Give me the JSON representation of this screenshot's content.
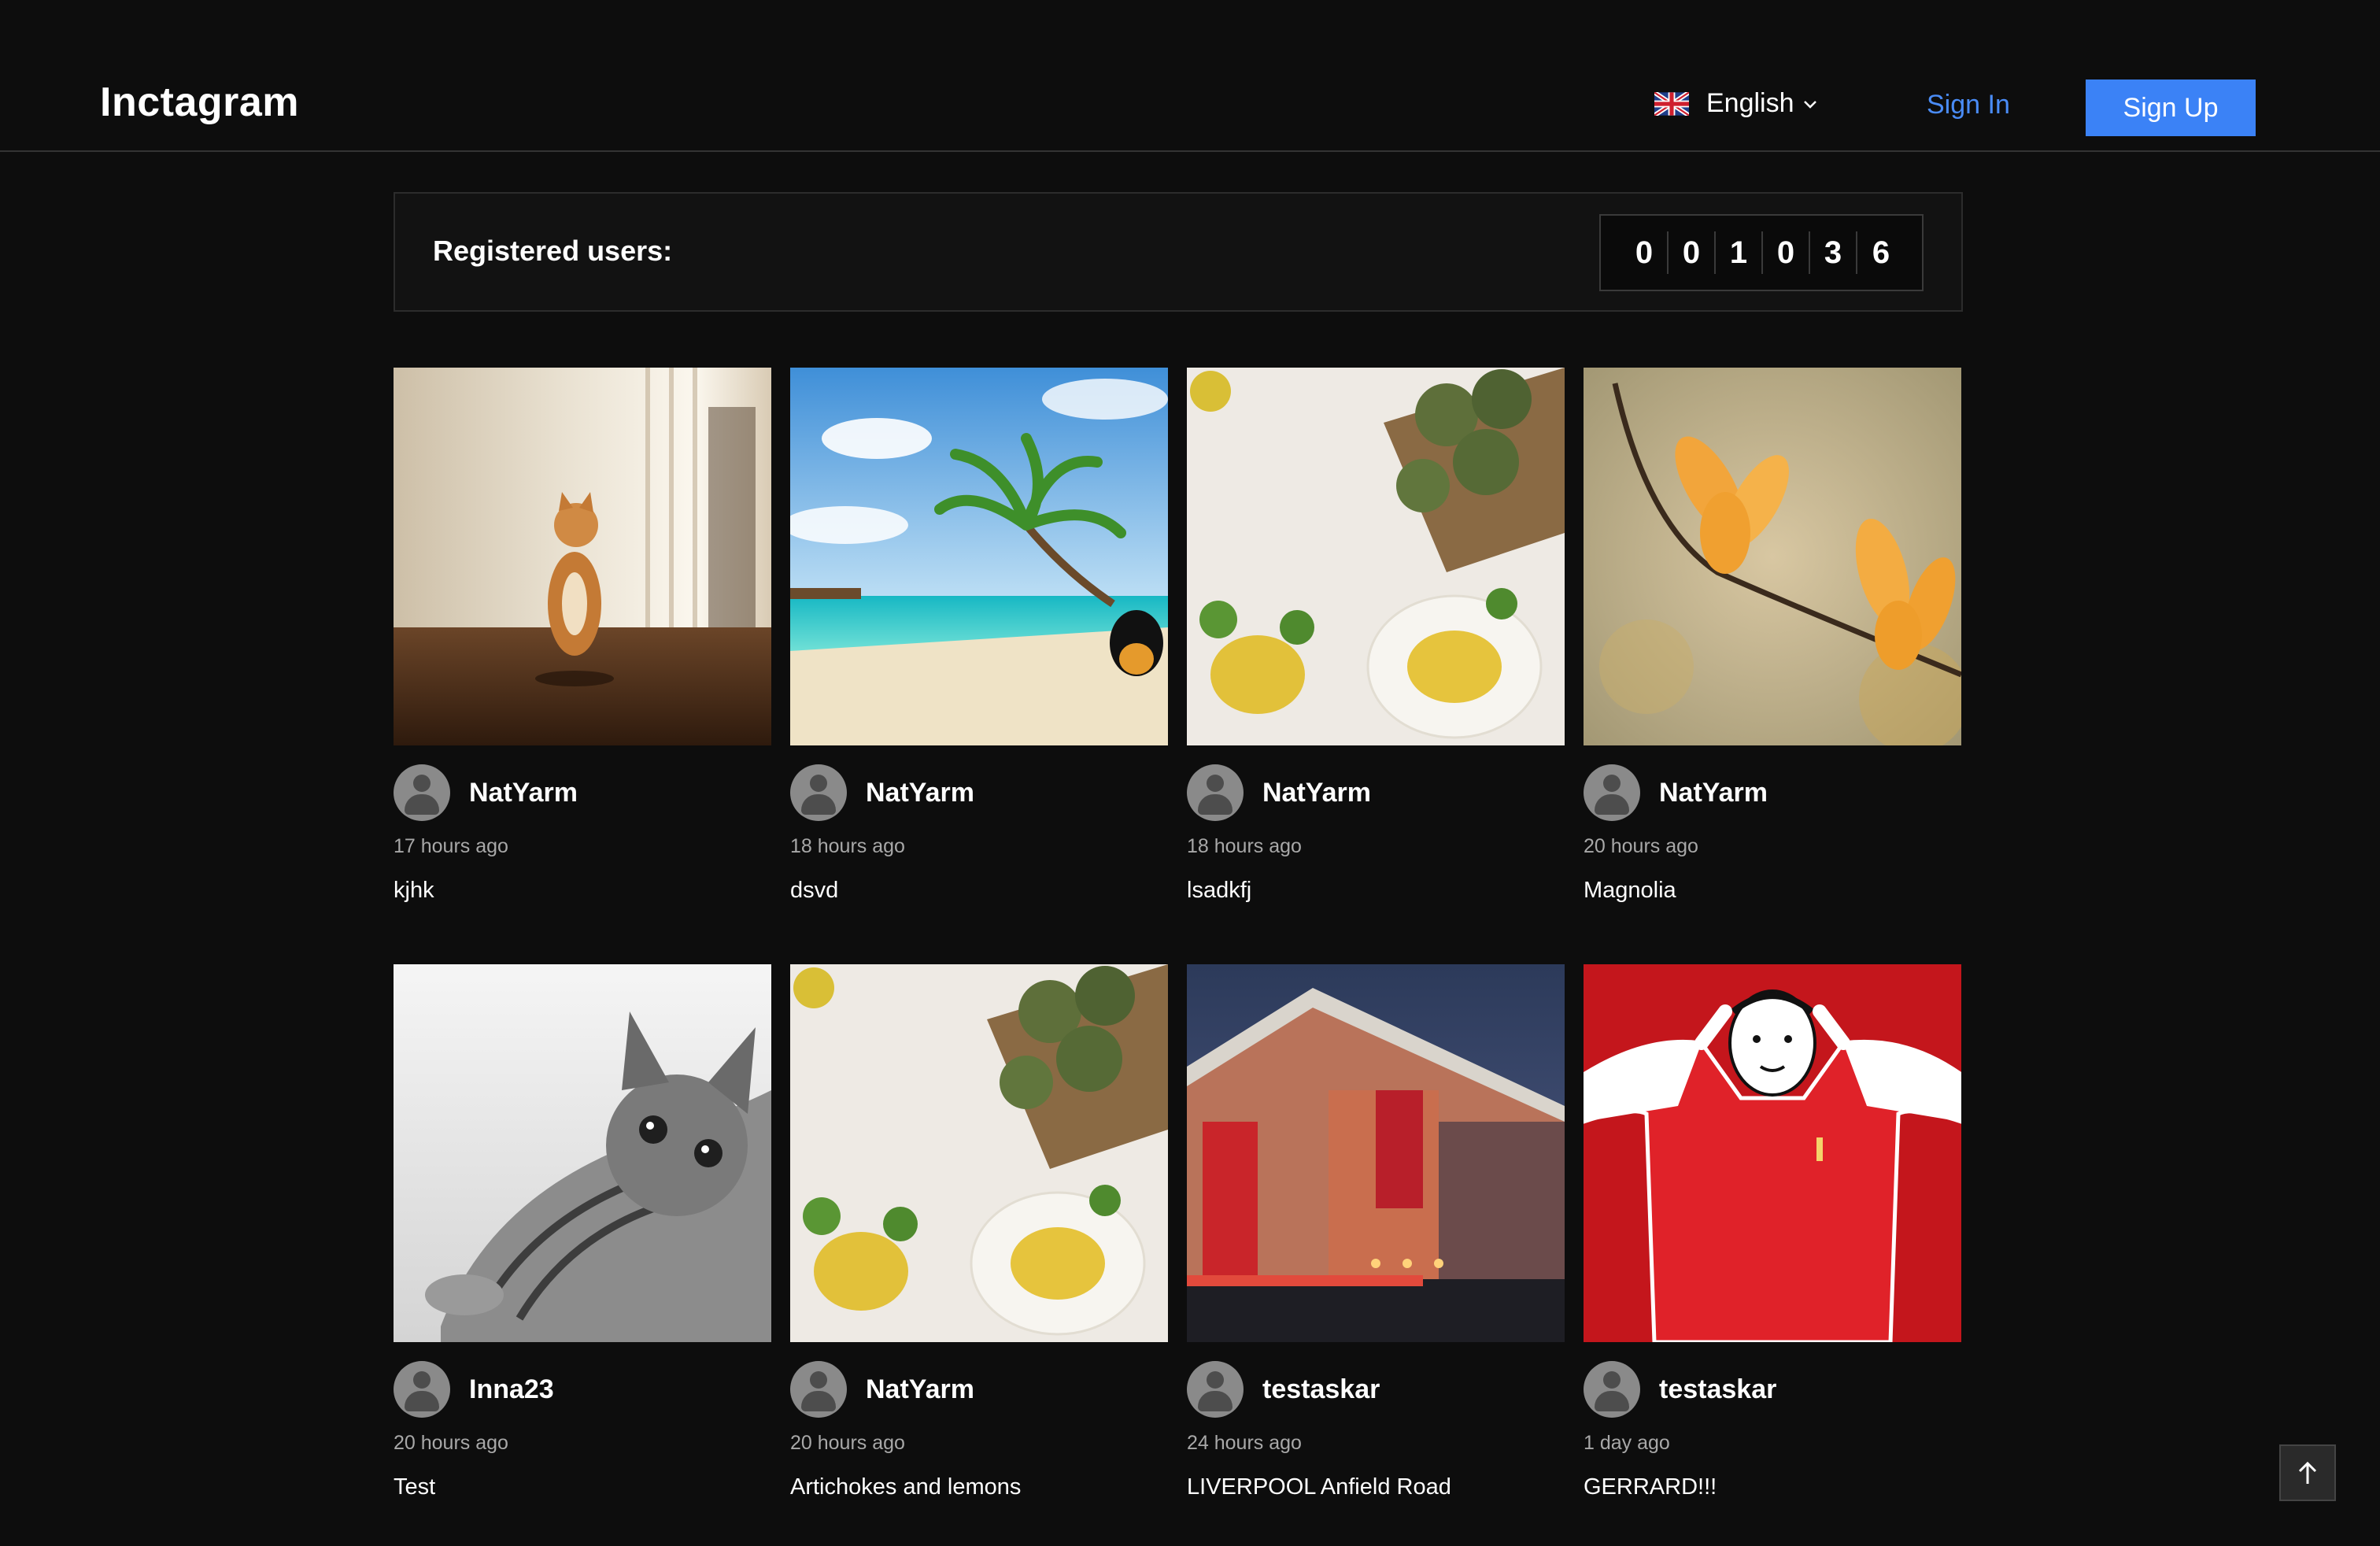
{
  "header": {
    "logo": "Inctagram",
    "language": {
      "label": "English",
      "flag_icon": "uk-flag-icon"
    },
    "sign_in": "Sign In",
    "sign_up": "Sign Up"
  },
  "registered": {
    "label": "Registered users:",
    "digits": [
      "0",
      "0",
      "1",
      "0",
      "3",
      "6"
    ]
  },
  "posts": [
    {
      "user": "NatYarm",
      "time": "17 hours ago",
      "caption": "kjhk",
      "image": "cat-by-window-photo"
    },
    {
      "user": "NatYarm",
      "time": "18 hours ago",
      "caption": "dsvd",
      "image": "tropical-beach-palm-photo"
    },
    {
      "user": "NatYarm",
      "time": "18 hours ago",
      "caption": "lsadkfj",
      "image": "artichokes-lemons-photo"
    },
    {
      "user": "NatYarm",
      "time": "20 hours ago",
      "caption": "Magnolia",
      "image": "yellow-magnolia-photo"
    },
    {
      "user": "Inna23",
      "time": "20 hours ago",
      "caption": "Test",
      "image": "grey-kitten-photo"
    },
    {
      "user": "NatYarm",
      "time": "20 hours ago",
      "caption": "Artichokes and lemons",
      "image": "artichokes-lemons-photo"
    },
    {
      "user": "testaskar",
      "time": "24 hours ago",
      "caption": "LIVERPOOL Anfield Road",
      "image": "anfield-stadium-photo"
    },
    {
      "user": "testaskar",
      "time": "1 day ago",
      "caption": "GERRARD!!!",
      "image": "gerrard-illustration"
    }
  ],
  "colors": {
    "background": "#0d0d0d",
    "accent": "#3b82f6",
    "link": "#4a8cf7"
  },
  "scroll_top_icon": "arrow-up-icon"
}
